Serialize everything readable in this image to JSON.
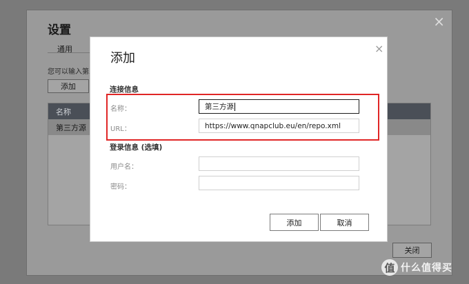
{
  "settings_window": {
    "title": "设置",
    "close_glyph": "×",
    "tab_label": "通用",
    "description": "您可以输入第三",
    "add_button": "添加",
    "table": {
      "header": "名称",
      "rows": [
        "第三方源"
      ]
    },
    "close_button": "关闭"
  },
  "dialog": {
    "title": "添加",
    "close_glyph": "×",
    "connection_section": "连接信息",
    "name_label": "名称：",
    "name_value": "第三方源",
    "url_label": "URL：",
    "url_value": "https://www.qnapclub.eu/en/repo.xml",
    "login_section": "登录信息 (选填)",
    "username_label": "用户名：",
    "username_value": "",
    "password_label": "密码：",
    "password_value": "",
    "add_button": "添加",
    "cancel_button": "取消",
    "highlight_color": "#e02525"
  },
  "watermark": {
    "badge": "值",
    "text": "什么值得买"
  }
}
